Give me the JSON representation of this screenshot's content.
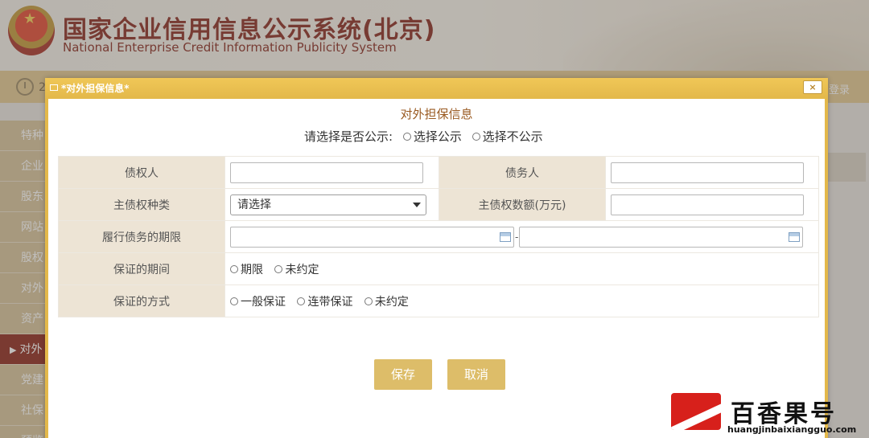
{
  "site": {
    "title": "国家企业信用信息公示系统(北京)",
    "subtitle": "National Enterprise Credit Information Publicity System",
    "bar_text": "2",
    "login_label": "登录"
  },
  "sidebar": {
    "items": [
      {
        "label": "特种"
      },
      {
        "label": "企业"
      },
      {
        "label": "股东"
      },
      {
        "label": "网站"
      },
      {
        "label": "股权"
      },
      {
        "label": "对外"
      },
      {
        "label": "资产"
      },
      {
        "label": "对外"
      },
      {
        "label": "党建"
      },
      {
        "label": "社保"
      },
      {
        "label": "预览"
      }
    ],
    "active_index": 7
  },
  "modal": {
    "title": "*对外担保信息*",
    "close_label": "×",
    "heading": "对外担保信息",
    "publish": {
      "prompt": "请选择是否公示:",
      "options": [
        "选择公示",
        "选择不公示"
      ]
    },
    "form": {
      "creditor_label": "债权人",
      "debtor_label": "债务人",
      "claim_type_label": "主债权种类",
      "claim_type_value": "请选择",
      "claim_amount_label": "主债权数额(万元)",
      "term_label": "履行债务的期限",
      "term_separator": "-",
      "guarantee_period_label": "保证的期间",
      "guarantee_period_options": [
        "期限",
        "未约定"
      ],
      "guarantee_method_label": "保证的方式",
      "guarantee_method_options": [
        "一般保证",
        "连带保证",
        "未约定"
      ]
    },
    "buttons": {
      "save": "保存",
      "cancel": "取消"
    }
  },
  "watermark": {
    "text": "百香果号",
    "url": "huangjinbaixiangguo.com"
  }
}
